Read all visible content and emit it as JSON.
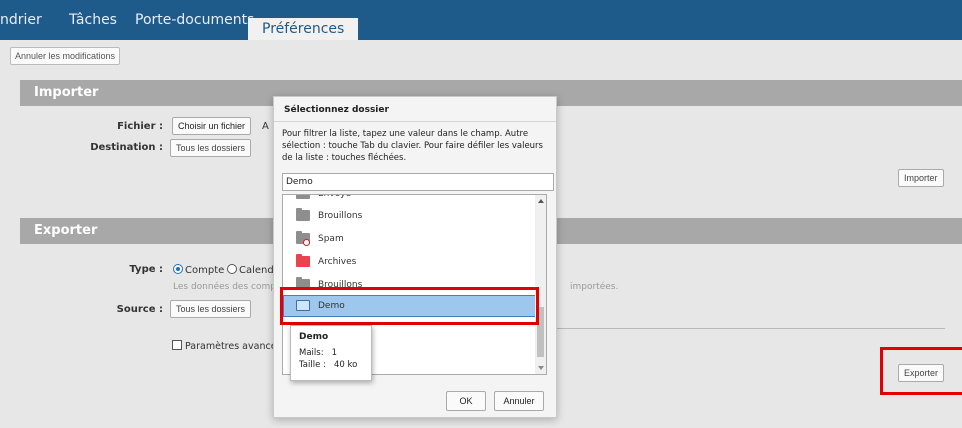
{
  "nav": {
    "tabs": [
      {
        "label": "ndrier"
      },
      {
        "label": "Tâches"
      },
      {
        "label": "Porte-documents"
      },
      {
        "label": "Préférences"
      }
    ],
    "bg_color": "#1e5a8a"
  },
  "toolbar": {
    "revert_label": "Annuler les modifications"
  },
  "import": {
    "header": "Importer",
    "file_label": "Fichier :",
    "file_button": "Choisir un fichier",
    "file_status": "A",
    "dest_label": "Destination :",
    "dest_value": "Tous les dossiers",
    "import_button": "Importer"
  },
  "export": {
    "header": "Exporter",
    "type_label": "Type :",
    "type_option_account": "Compte",
    "type_option_calendar": "Calend",
    "note_left": "Les données des comp",
    "note_right": "importées.",
    "source_label": "Source :",
    "source_value": "Tous les dossiers",
    "advanced_label": "Paramètres avancés",
    "export_button": "Exporter"
  },
  "dialog": {
    "title": "Sélectionnez dossier",
    "help_text": "Pour filtrer la liste, tapez une valeur dans le champ. Autre sélection : touche Tab du clavier. Pour faire défiler les valeurs de la liste : touches fléchées.",
    "input_value": "Demo",
    "folders": [
      {
        "label": "Envoyé",
        "icon": "sent-folder-icon"
      },
      {
        "label": "Brouillons",
        "icon": "drafts-folder-icon"
      },
      {
        "label": "Spam",
        "icon": "spam-folder-icon"
      },
      {
        "label": "Archives",
        "icon": "archive-folder-icon"
      },
      {
        "label": "Brouillons",
        "icon": "folder-icon"
      },
      {
        "label": "Demo",
        "icon": "folder-icon",
        "selected": true
      }
    ],
    "ok_label": "OK",
    "cancel_label": "Annuler"
  },
  "tooltip": {
    "title": "Demo",
    "mails": "Mails:   1",
    "size": "Taille :   40 ko"
  },
  "colors": {
    "highlight_red": "#e30000",
    "selection_blue": "#9dc7ec"
  }
}
